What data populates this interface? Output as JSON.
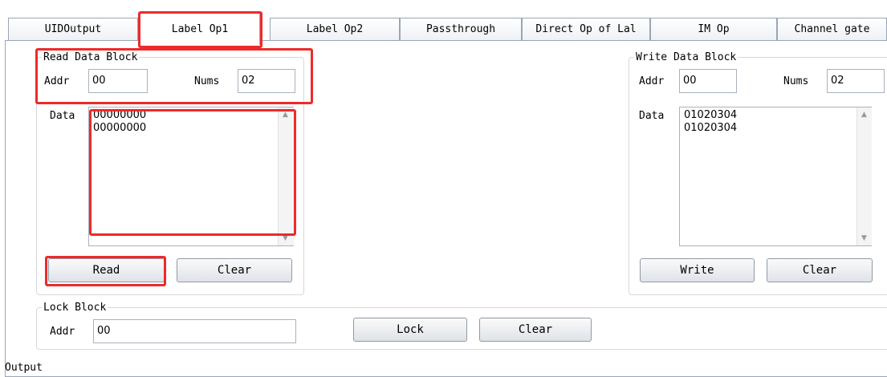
{
  "tabs": [
    {
      "label": "UIDOutput"
    },
    {
      "label": "Label Op1"
    },
    {
      "label": "Label Op2"
    },
    {
      "label": "Passthrough"
    },
    {
      "label": "Direct Op of Lal"
    },
    {
      "label": "IM Op"
    },
    {
      "label": "Channel gate"
    }
  ],
  "read_block": {
    "title": "Read Data Block",
    "addr_label": "Addr",
    "addr_value": "00",
    "nums_label": "Nums",
    "nums_value": "02",
    "data_label": "Data",
    "data_lines": "00000000\n00000000",
    "read_button": "Read",
    "clear_button": "Clear"
  },
  "write_block": {
    "title": "Write Data Block",
    "addr_label": "Addr",
    "addr_value": "00",
    "nums_label": "Nums",
    "nums_value": "02",
    "data_label": "Data",
    "data_lines": "01020304\n01020304",
    "write_button": "Write",
    "clear_button": "Clear"
  },
  "lock_block": {
    "title": "Lock Block",
    "addr_label": "Addr",
    "addr_value": "00",
    "lock_button": "Lock",
    "clear_button": "Clear"
  },
  "output": {
    "title": "Output"
  },
  "colors": {
    "highlight": "#ee2a2a",
    "border": "#9aa6b4"
  }
}
